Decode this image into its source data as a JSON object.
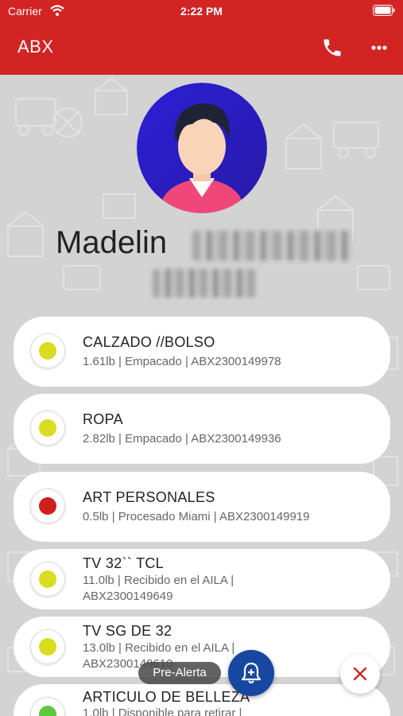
{
  "statusbar": {
    "carrier": "Carrier",
    "time": "2:22 PM"
  },
  "appbar": {
    "title": "ABX",
    "icons": [
      "phone-icon",
      "more-icon"
    ]
  },
  "profile": {
    "first_name": "Madelin"
  },
  "colors": {
    "brand_red": "#d32424",
    "fab_blue": "#1747a0",
    "status_yellow": "#d9dc1f",
    "status_red": "#d11f1f",
    "status_green": "#5cc83c"
  },
  "packages": [
    {
      "title": "CALZADO //BOLSO",
      "subtitle": "1.61lb | Empacado | ABX2300149978",
      "status_color": "#d9dc1f"
    },
    {
      "title": "ROPA",
      "subtitle": "2.82lb | Empacado | ABX2300149936",
      "status_color": "#d9dc1f"
    },
    {
      "title": "ART PERSONALES",
      "subtitle": "0.5lb | Procesado Miami | ABX2300149919",
      "status_color": "#d11f1f"
    },
    {
      "title": "TV 32`` TCL",
      "subtitle": "11.0lb | Recibido en el AILA |",
      "subtitle2": "ABX2300149649",
      "status_color": "#d9dc1f"
    },
    {
      "title": "TV SG DE 32",
      "subtitle": "13.0lb | Recibido en el AILA |",
      "subtitle2": "ABX2300149610",
      "status_color": "#d9dc1f"
    },
    {
      "title": "ARTICULO DE BELLEZA",
      "subtitle": "1.0lb | Disponible para retirar |",
      "status_color": "#5cc83c"
    }
  ],
  "fab": {
    "prealert_label": "Pre-Alerta"
  }
}
